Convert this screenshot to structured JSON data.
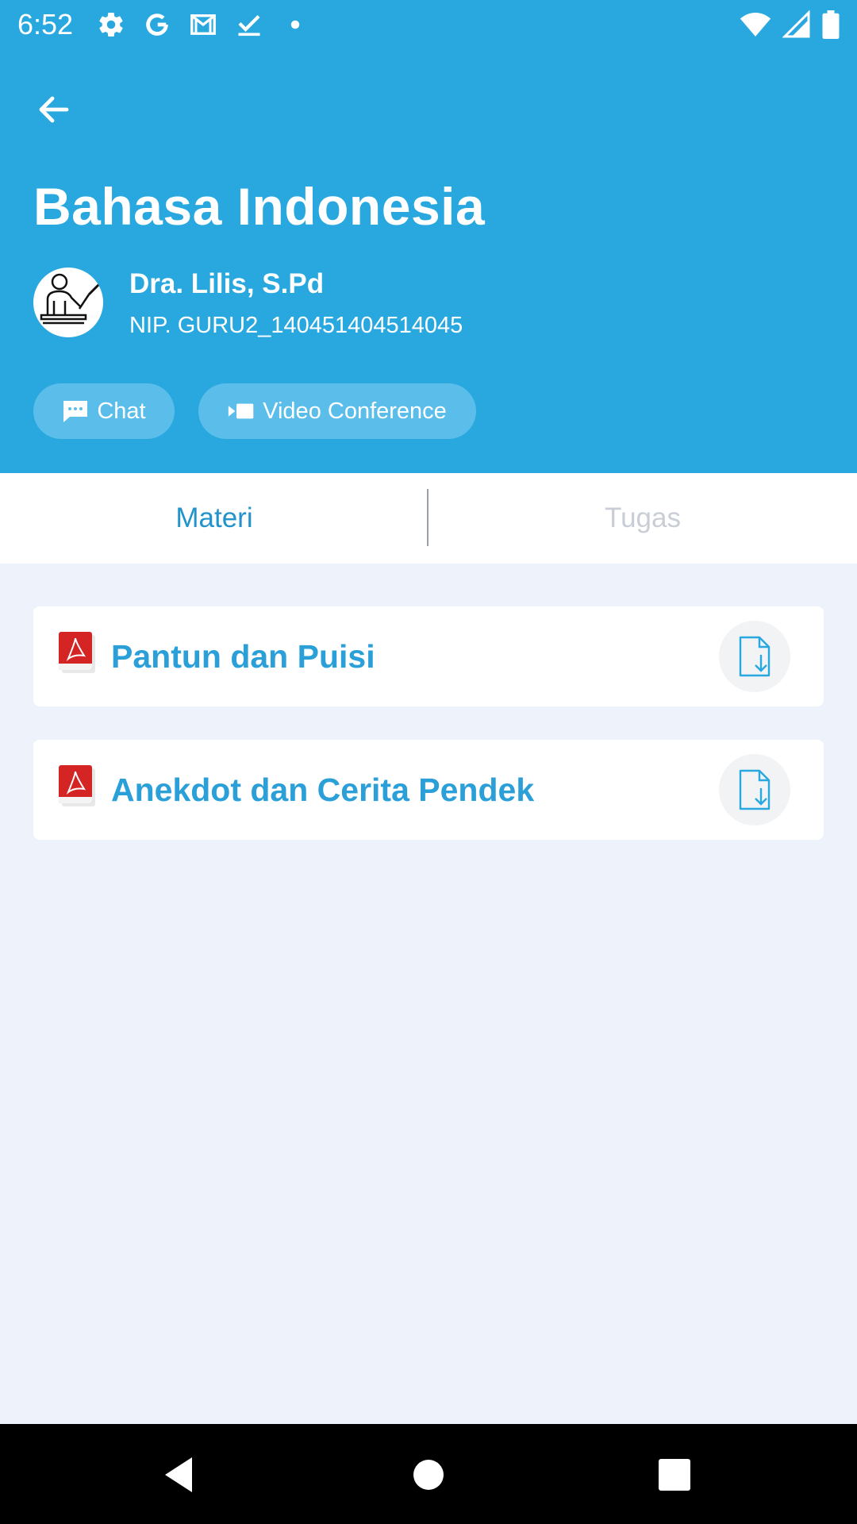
{
  "status_bar": {
    "time": "6:52",
    "icons": [
      "settings-icon",
      "google-icon",
      "gmail-icon",
      "checkmark-icon",
      "dot-icon",
      "wifi-icon",
      "signal-icon",
      "battery-icon"
    ]
  },
  "header": {
    "title": "Bahasa Indonesia",
    "background_color": "#29A8E0",
    "teacher": {
      "name": "Dra. Lilis, S.Pd",
      "nip": "NIP. GURU2_140451404514045"
    },
    "buttons": {
      "chat_label": "Chat",
      "video_label": "Video Conference"
    }
  },
  "tabs": [
    {
      "label": "Materi",
      "active": true
    },
    {
      "label": "Tugas",
      "active": false
    }
  ],
  "materials": [
    {
      "title": "Pantun dan Puisi",
      "icon": "pdf-icon",
      "action_icon": "download-file-icon"
    },
    {
      "title": "Anekdot dan Cerita Pendek",
      "icon": "pdf-icon",
      "action_icon": "download-file-icon"
    }
  ],
  "colors": {
    "accent": "#2A9FD8",
    "page_background": "#EEF3FB",
    "tab_inactive": "#C9CED6"
  }
}
